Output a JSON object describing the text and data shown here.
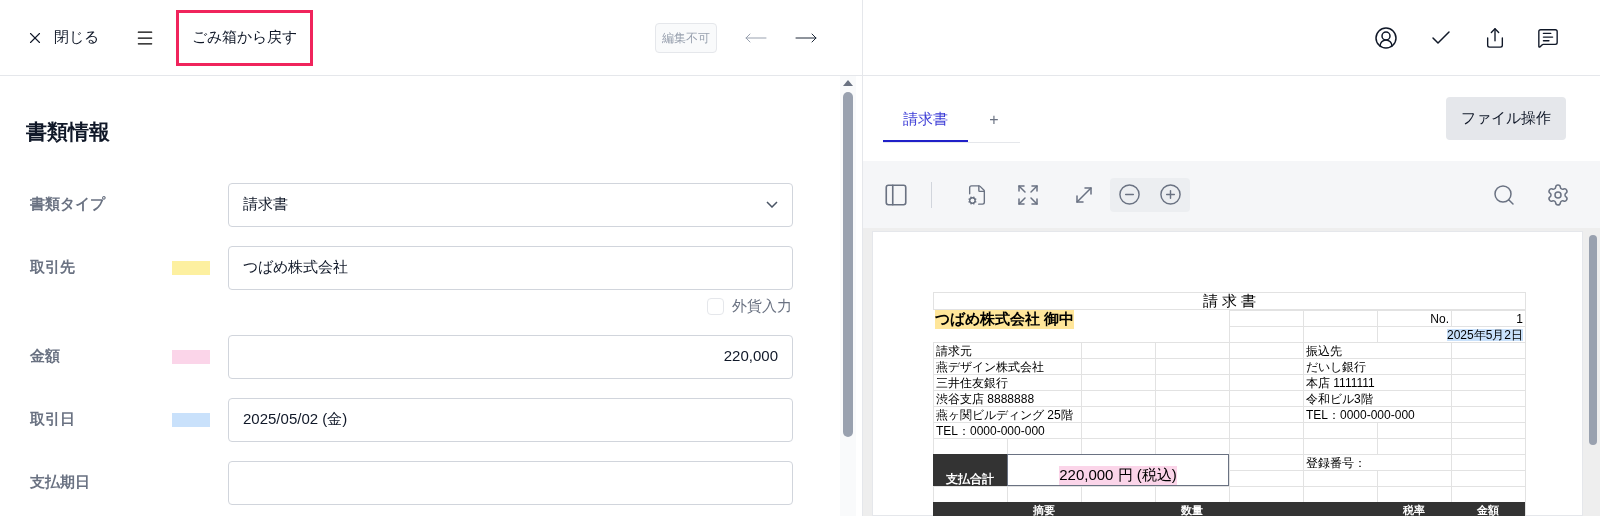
{
  "header": {
    "close_label": "閉じる",
    "restore_button": "ごみ箱から戻す",
    "status_badge": "編集不可"
  },
  "document_info": {
    "title": "書類情報",
    "fields": [
      {
        "kind": "select",
        "label": "書類タイプ",
        "value": "請求書"
      },
      {
        "kind": "text",
        "label": "取引先",
        "value": "つばめ株式会社",
        "color": "#fdf0a0"
      },
      {
        "kind": "checkbox",
        "label": "外貨入力",
        "checked": false
      },
      {
        "kind": "amount",
        "label": "金額",
        "value": "220,000",
        "color": "#fbd5e9"
      },
      {
        "kind": "text",
        "label": "取引日",
        "value": "2025/05/02 (金)",
        "color": "#c9e1fb"
      },
      {
        "kind": "text",
        "label": "支払期日"
      }
    ]
  },
  "preview": {
    "tabs": [
      {
        "label": "請求書",
        "selected": true
      }
    ],
    "add_tab": "+",
    "file_button": "ファイル操作",
    "invoice": {
      "title": "請 求 書",
      "addressee": "つばめ株式会社  御中",
      "no_label": "No.",
      "no_value": "1",
      "date": "2025年5月2日",
      "issuer_lines": [
        "請求元",
        "燕デザイン株式会社",
        "三井住友銀行",
        "渋谷支店 8888888",
        "燕ヶ関ビルディング  25階",
        "TEL：0000-000-000"
      ],
      "payee_lines": [
        "振込先",
        "だいし銀行",
        "本店 1111111",
        "令和ビル3階",
        "TEL：0000-000-000"
      ],
      "total_label": "支払合計",
      "total_value": "220,000 円 (税込)",
      "registration_label": "登録番号：",
      "columns": [
        {
          "label": "摘要"
        },
        {
          "label": "数量"
        },
        {
          "label": "税率"
        },
        {
          "label": "金額"
        }
      ]
    }
  }
}
